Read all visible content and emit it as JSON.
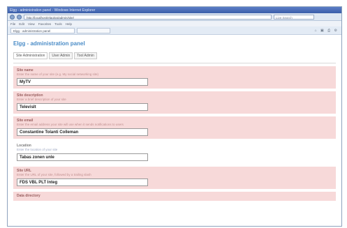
{
  "browser": {
    "window_title": "Elgg - administration panel - Windows Internet Explorer",
    "address": "http://localhost/elgg/pg/admin/site/",
    "search_placeholder": "Live Search",
    "menu_items": [
      "File",
      "Edit",
      "View",
      "Favorites",
      "Tools",
      "Help"
    ],
    "tabs": [
      {
        "label": "Elgg - administration panel",
        "active": true
      },
      {
        "label": "",
        "active": false
      }
    ],
    "toolbar_icons": "⌂ ▣ ⎙ ⚙"
  },
  "page": {
    "title": "Elgg - administration panel",
    "tabs": [
      {
        "label": "Site Administration",
        "active": true
      },
      {
        "label": "User Admin",
        "active": false
      },
      {
        "label": "Tool Admin",
        "active": false
      }
    ],
    "fields": [
      {
        "label": "Site name",
        "description": "Enter the name of your site (e.g. My social networking site)",
        "value": "MyTV",
        "highlighted": true
      },
      {
        "label": "Site description",
        "description": "Enter a brief description of your site",
        "value": "TelevisIt",
        "highlighted": true
      },
      {
        "label": "Site email",
        "description": "Enter the email address your site will use when it sends notifications to users",
        "value": "Constantine Tolanti Colleman",
        "highlighted": true
      },
      {
        "label": "Location",
        "description": "Enter the location of your site",
        "value": "Tabas zonen unle",
        "highlighted": false
      },
      {
        "label": "Site URL",
        "description": "Enter the URL of your site, followed by a trailing slash",
        "value": "FDS VBL PLT Integ",
        "highlighted": true
      },
      {
        "label": "Data directory",
        "description": "",
        "value": "",
        "highlighted": true
      }
    ]
  }
}
